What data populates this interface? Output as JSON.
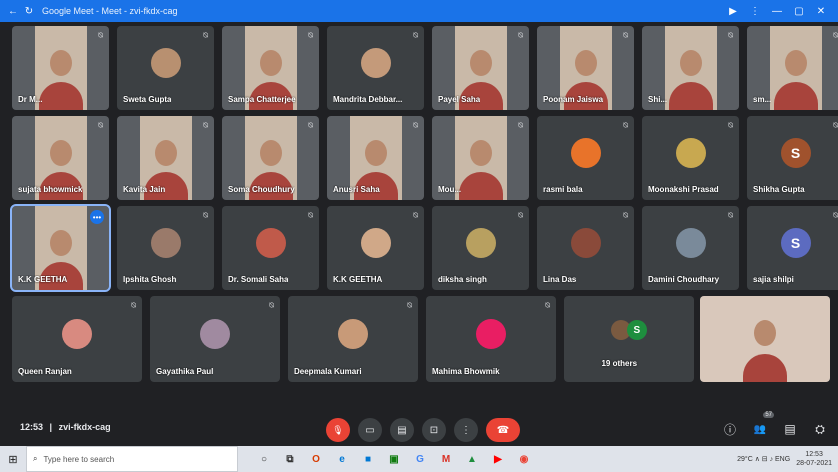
{
  "titlebar": {
    "title": "Google Meet - Meet - zvi-fkdx-cag",
    "back": "←",
    "reload": "↻",
    "controls": [
      "▶",
      "⋮",
      "—",
      "▢",
      "✕"
    ]
  },
  "row1": [
    {
      "name": "Dr M...",
      "kind": "video"
    },
    {
      "name": "Sweta Gupta",
      "kind": "avatar",
      "color": "#b89070"
    },
    {
      "name": "Sampa Chatterjee",
      "kind": "video"
    },
    {
      "name": "Mandrita Debbar...",
      "kind": "avatar",
      "color": "#c49a7a"
    },
    {
      "name": "Payel Saha",
      "kind": "video"
    },
    {
      "name": "Poonam Jaiswa",
      "kind": "video"
    },
    {
      "name": "Shi...",
      "kind": "video"
    },
    {
      "name": "sm...",
      "kind": "video"
    }
  ],
  "row2": [
    {
      "name": "sujata bhowmick",
      "kind": "video"
    },
    {
      "name": "Kavita Jain",
      "kind": "video"
    },
    {
      "name": "Soma Choudhury",
      "kind": "video"
    },
    {
      "name": "Anusri Saha",
      "kind": "video"
    },
    {
      "name": "Mou...",
      "kind": "video"
    },
    {
      "name": "rasmi bala",
      "kind": "avatar",
      "color": "#e8732a"
    },
    {
      "name": "Moonakshi Prasad",
      "kind": "avatar",
      "color": "#c8a850"
    },
    {
      "name": "Shikha Gupta",
      "kind": "letter",
      "letter": "S",
      "color": "#a0522d"
    }
  ],
  "row3": [
    {
      "name": "K.K GEETHA",
      "kind": "video",
      "active": true
    },
    {
      "name": "Ipshita Ghosh",
      "kind": "avatar",
      "color": "#9a7a6a"
    },
    {
      "name": "Dr. Somali Saha",
      "kind": "avatar",
      "color": "#c05a4a"
    },
    {
      "name": "K.K GEETHA",
      "kind": "avatar",
      "color": "#d0a888"
    },
    {
      "name": "diksha singh",
      "kind": "avatar",
      "color": "#b8a060"
    },
    {
      "name": "Lina Das",
      "kind": "avatar",
      "color": "#8a4a3a"
    },
    {
      "name": "Damini Choudhary",
      "kind": "avatar",
      "color": "#7a8a9a"
    },
    {
      "name": "sajia shilpi",
      "kind": "letter",
      "letter": "S",
      "color": "#5c6bc0"
    }
  ],
  "row4": [
    {
      "name": "Queen Ranjan",
      "kind": "avatar",
      "color": "#d88a80"
    },
    {
      "name": "Gayathika Paul",
      "kind": "avatar",
      "color": "#a08aa0"
    },
    {
      "name": "Deepmala Kumari",
      "kind": "avatar",
      "color": "#c89a78"
    },
    {
      "name": "Mahima Bhowmik",
      "kind": "avatar",
      "color": "#e91e63"
    },
    {
      "name": "19 others",
      "kind": "others",
      "letter": "S"
    },
    {
      "name": "",
      "kind": "self"
    }
  ],
  "bottombar": {
    "time": "12:53",
    "meeting_code": "zvi-fkdx-cag",
    "separator": "|",
    "mic_icon": "🎙",
    "camera_icon": "▭",
    "captions_icon": "▤",
    "present_icon": "⊡",
    "more_icon": "⋮",
    "end_icon": "☎",
    "info_icon": "ⓘ",
    "people_icon": "👥",
    "chat_icon": "▤",
    "activities_icon": "⛭",
    "participant_count": "57"
  },
  "taskbar": {
    "start_icon": "⊞",
    "search_placeholder": "Type here to search",
    "apps": [
      {
        "icon": "○",
        "color": "#333"
      },
      {
        "icon": "⧉",
        "color": "#333"
      },
      {
        "icon": "O",
        "color": "#d83b01"
      },
      {
        "icon": "e",
        "color": "#0078d4"
      },
      {
        "icon": "■",
        "color": "#0078d4"
      },
      {
        "icon": "▣",
        "color": "#107c10"
      },
      {
        "icon": "G",
        "color": "#4285f4"
      },
      {
        "icon": "M",
        "color": "#d93025"
      },
      {
        "icon": "▲",
        "color": "#1e8e3e"
      },
      {
        "icon": "▶",
        "color": "#ff0000"
      },
      {
        "icon": "◉",
        "color": "#ea4335"
      }
    ],
    "tray_text": "29°C  ∧  ⊟  ♪  ENG",
    "clock_time": "12:53",
    "clock_date": "28-07-2021"
  },
  "colors": {
    "background": "#202124",
    "tile": "#3c4043",
    "accent": "#1a73e8",
    "end_call": "#ea4335"
  }
}
